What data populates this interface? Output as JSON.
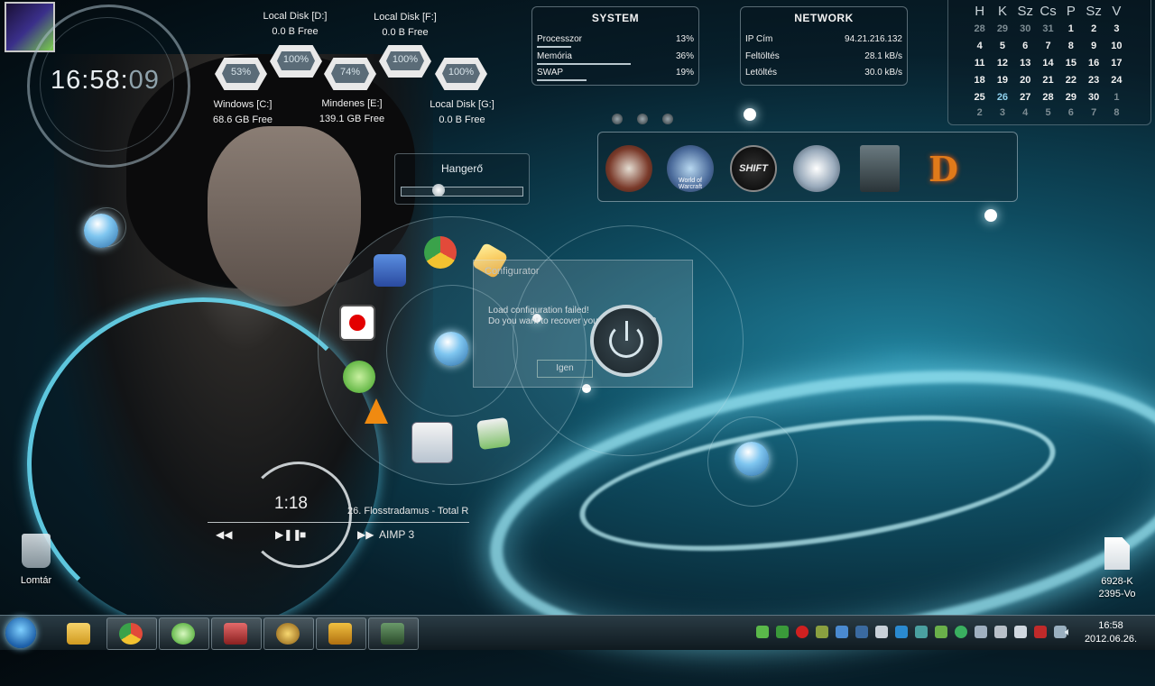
{
  "clock": {
    "hm": "16:58:",
    "sec": "09"
  },
  "drives": [
    {
      "name": "Local Disk [D:]",
      "free": "0.0 B Free",
      "pct": "100%"
    },
    {
      "name": "Local Disk [F:]",
      "free": "0.0 B Free",
      "pct": "100%"
    },
    {
      "name": "Windows [C:]",
      "free": "68.6 GB Free",
      "pct": "53%"
    },
    {
      "name": "Mindenes [E:]",
      "free": "139.1 GB Free",
      "pct": "74%"
    },
    {
      "name": "Local Disk [G:]",
      "free": "0.0 B Free",
      "pct": "100%"
    }
  ],
  "system": {
    "title": "SYSTEM",
    "rows": [
      {
        "label": "Processzor",
        "value": "13%",
        "level": 13
      },
      {
        "label": "Memória",
        "value": "36%",
        "level": 36
      },
      {
        "label": "SWAP",
        "value": "19%",
        "level": 19
      }
    ]
  },
  "network": {
    "title": "NETWORK",
    "rows": [
      {
        "label": "IP Cím",
        "value": "94.21.216.132"
      },
      {
        "label": "Feltöltés",
        "value": "28.1 kB/s"
      },
      {
        "label": "Letöltés",
        "value": "30.0 kB/s"
      }
    ]
  },
  "calendar": {
    "headers": [
      "H",
      "K",
      "Sz",
      "Cs",
      "P",
      "Sz",
      "V"
    ],
    "weeks": [
      [
        "28",
        "29",
        "30",
        "31",
        "1",
        "2",
        "3"
      ],
      [
        "4",
        "5",
        "6",
        "7",
        "8",
        "9",
        "10"
      ],
      [
        "11",
        "12",
        "13",
        "14",
        "15",
        "16",
        "17"
      ],
      [
        "18",
        "19",
        "20",
        "21",
        "22",
        "23",
        "24"
      ],
      [
        "25",
        "26",
        "27",
        "28",
        "29",
        "30",
        "1"
      ],
      [
        "2",
        "3",
        "4",
        "5",
        "6",
        "7",
        "8"
      ]
    ]
  },
  "volume": {
    "title": "Hangerő",
    "level": 28
  },
  "games": [
    "World of Warcraft",
    "SHIFT"
  ],
  "dialog": {
    "title": "Configurator",
    "msg1": "Load configuration failed!",
    "msg2": "Do you want to recover your last settings?",
    "button": "Igen"
  },
  "player": {
    "time": "1:18",
    "track": "26. Flosstradamus - Total R",
    "app": "AIMP 3"
  },
  "desktop": {
    "trash": "Lomtár",
    "file": [
      "6928-K",
      "2395-Vo"
    ]
  },
  "tray": {
    "time": "16:58",
    "date": "2012.06.26."
  },
  "colors": {
    "accent": "#7fe3ff",
    "panel_border": "#bed2dc"
  }
}
